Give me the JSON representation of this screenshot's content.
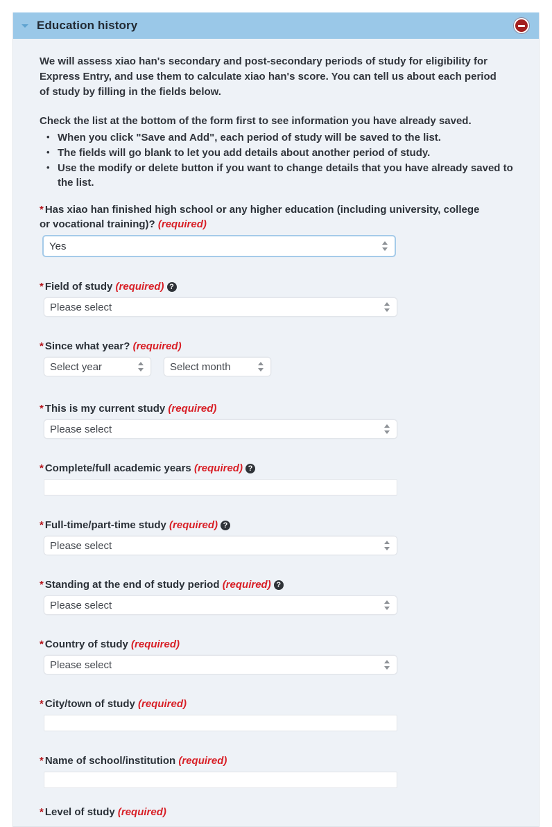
{
  "panel": {
    "title": "Education history",
    "collapse_icon": "caret-down-icon",
    "remove_icon": "minus-circle-icon"
  },
  "intro": {
    "paragraph1": "We will assess xiao han's secondary and post-secondary periods of study for eligibility for Express Entry, and use them to calculate xiao han's score. You can tell us about each period of study by filling in the fields below.",
    "paragraph2": "Check the list at the bottom of the form first to see information you have already saved.",
    "bullets": [
      "When you click \"Save and Add\", each period of study will be saved to the list.",
      "The fields will go blank to let you add details about another period of study.",
      "Use the modify or delete button if you want to change details that you have already saved to the list."
    ]
  },
  "required_marker": "*",
  "required_text": "(required)",
  "fields": {
    "finished_school": {
      "label": "Has xiao han finished high school or any higher education (including university, college or vocational training)?",
      "value": "Yes"
    },
    "field_of_study": {
      "label": "Field of study",
      "value": "Please select",
      "help": true
    },
    "since_year": {
      "label": "Since what year?",
      "year_value": "Select year",
      "month_value": "Select month"
    },
    "current_study": {
      "label": "This is my current study",
      "value": "Please select"
    },
    "academic_years": {
      "label": "Complete/full academic years",
      "value": "",
      "help": true
    },
    "full_part_time": {
      "label": "Full-time/part-time study",
      "value": "Please select",
      "help": true
    },
    "standing": {
      "label": "Standing at the end of study period",
      "value": "Please select",
      "help": true
    },
    "country": {
      "label": "Country of study",
      "value": "Please select"
    },
    "city": {
      "label": "City/town of study",
      "value": ""
    },
    "school_name": {
      "label": "Name of school/institution",
      "value": ""
    },
    "level_of_study": {
      "label": "Level of study"
    }
  },
  "help_icon_glyph": "?",
  "colors": {
    "header_blue": "#9ac8e8",
    "body_bg": "#eef2f7",
    "required_red": "#d81f26",
    "remove_red": "#a31f1f",
    "focus_blue": "#a5cbe9"
  }
}
